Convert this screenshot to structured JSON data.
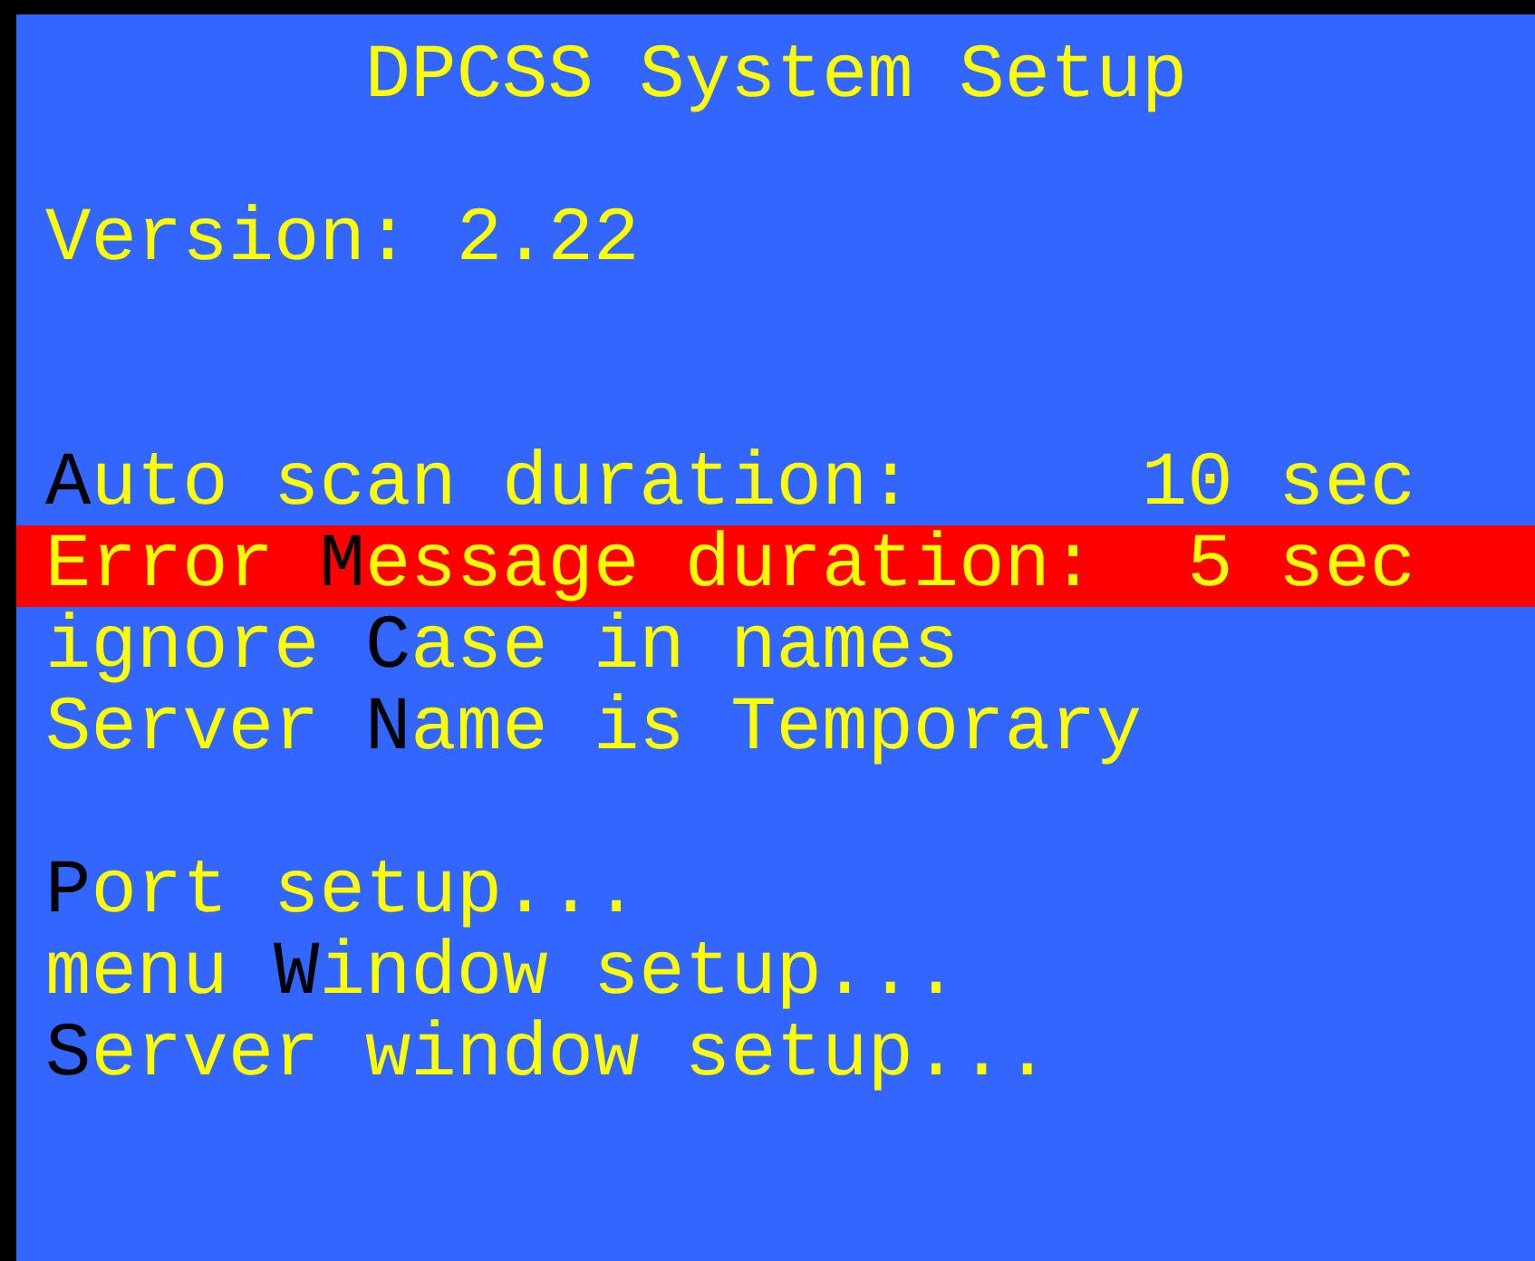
{
  "title": "DPCSS System Setup",
  "version": {
    "label": "Version:",
    "value": "2.22"
  },
  "settings": [
    {
      "hotkey": "A",
      "suffix": "uto scan duration:",
      "value": "10 sec",
      "selected": false
    },
    {
      "prefix": "Error ",
      "hotkey": "M",
      "suffix": "essage duration:",
      "value": "5 sec",
      "selected": true
    },
    {
      "prefix": "ignore ",
      "hotkey": "C",
      "suffix": "ase in names",
      "selected": false
    },
    {
      "prefix": "Server ",
      "hotkey": "N",
      "suffix": "ame is Temporary",
      "selected": false
    }
  ],
  "submenus": [
    {
      "hotkey": "P",
      "suffix": "ort setup...",
      "selected": false
    },
    {
      "prefix": "menu ",
      "hotkey": "W",
      "suffix": "indow setup...",
      "selected": false
    },
    {
      "hotkey": "S",
      "suffix": "erver window setup...",
      "selected": false
    }
  ]
}
